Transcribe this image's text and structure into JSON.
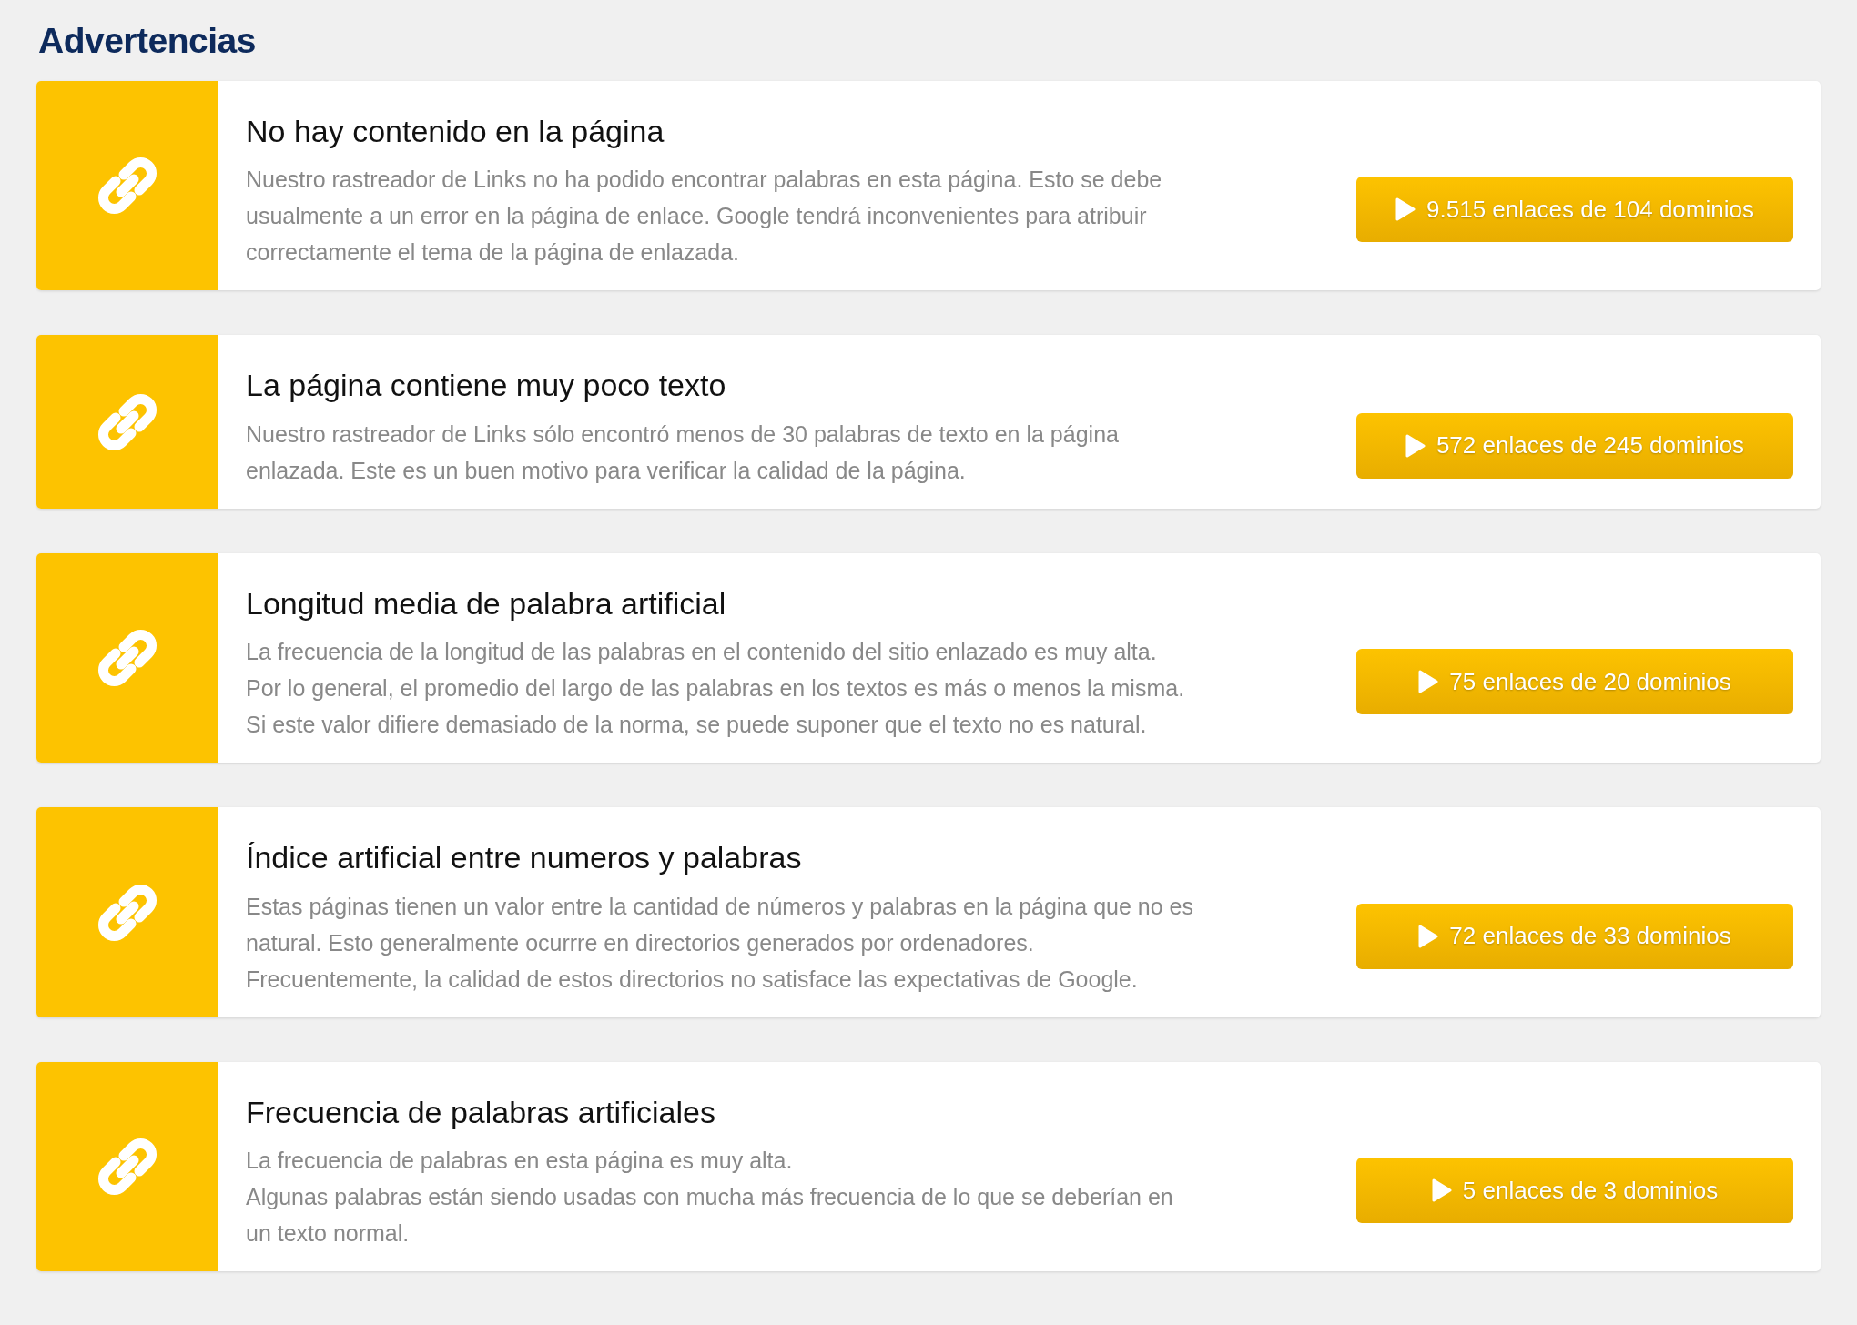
{
  "heading": "Advertencias",
  "warnings": [
    {
      "title": "No hay contenido en la página",
      "description": "Nuestro rastreador de Links no ha podido encontrar palabras en esta página. Esto se debe\nusualmente a un error en la página de enlace. Google tendrá inconvenientes para atribuir\ncorrectamente el tema de la página de enlazada.",
      "button": "9.515 enlaces de 104 dominios"
    },
    {
      "title": "La página contiene muy poco texto",
      "description": "Nuestro rastreador de Links sólo encontró menos de 30 palabras de texto en la página\nenlazada. Este es un buen motivo para verificar la calidad de la página.",
      "button": "572 enlaces de 245 dominios"
    },
    {
      "title": "Longitud media de palabra artificial",
      "description": "La frecuencia de la longitud de las palabras en el contenido del sitio enlazado es muy alta.\nPor lo general, el promedio del largo de las palabras en los textos es más o menos la misma.\nSi este valor difiere demasiado de la norma, se puede suponer que el texto no es natural.",
      "button": "75 enlaces de 20 dominios"
    },
    {
      "title": "Índice artificial entre numeros y palabras",
      "description": "Estas páginas tienen un valor entre la cantidad de números y palabras en la página que no es\nnatural. Esto generalmente ocurrre en directorios generados por ordenadores.\nFrecuentemente, la calidad de estos directorios no satisface las expectativas de Google.",
      "button": "72 enlaces de 33 dominios"
    },
    {
      "title": "Frecuencia de palabras artificiales",
      "description": "La frecuencia de palabras en esta página es muy alta.\nAlgunas palabras están siendo usadas con mucha más frecuencia de lo que se deberían en\nun texto normal.",
      "button": "5 enlaces de 3 dominios"
    }
  ]
}
